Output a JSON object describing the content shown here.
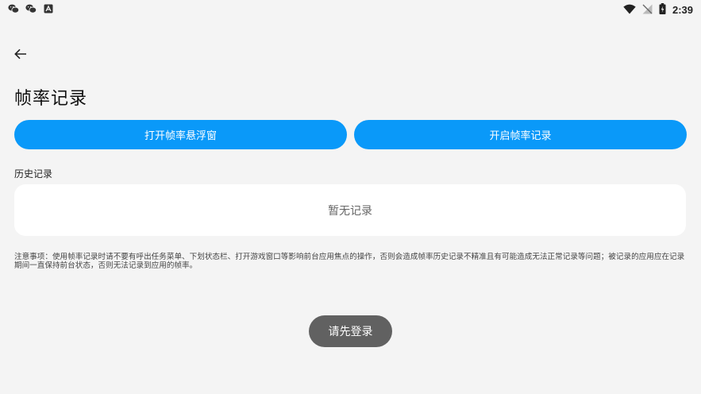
{
  "status_bar": {
    "left_icons": [
      "wechat-icon",
      "wechat-icon",
      "app-notification-icon"
    ],
    "right_icons": [
      "wifi-icon",
      "no-signal-icon",
      "battery-icon"
    ],
    "time": "2:39"
  },
  "header": {
    "title": "帧率记录"
  },
  "actions": {
    "open_float_label": "打开帧率悬浮窗",
    "start_record_label": "开启帧率记录"
  },
  "history": {
    "label": "历史记录",
    "empty_text": "暂无记录"
  },
  "notice": "注意事项：使用帧率记录时请不要有呼出任务菜单、下划状态栏、打开游戏窗口等影响前台应用焦点的操作，否则会造成帧率历史记录不精准且有可能造成无法正常记录等问题；被记录的应用应在记录期间一直保持前台状态，否则无法记录到应用的帧率。",
  "login_button": "请先登录",
  "colors": {
    "primary": "#0a99f9",
    "background": "#f4f4f4",
    "card": "#ffffff",
    "login_bg": "#616161"
  }
}
